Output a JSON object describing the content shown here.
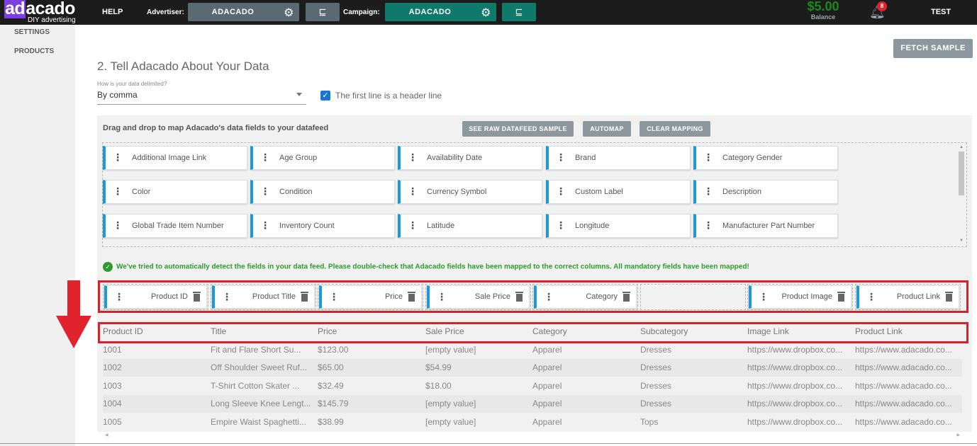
{
  "topbar": {
    "logo_ad": "ad",
    "logo_rest": "acado",
    "logo_sub": "DIY advertising",
    "help": "HELP",
    "advertiser_label": "Advertiser:",
    "advertiser_value": "ADACADO",
    "campaign_label": "Campaign:",
    "campaign_value": "ADACADO",
    "balance_amount": "$5.00",
    "balance_label": "Balance",
    "notification_count": "8",
    "user": "TEST"
  },
  "sidebar": {
    "items": [
      {
        "label": "SETTINGS"
      },
      {
        "label": "PRODUCTS"
      }
    ]
  },
  "main": {
    "fetch_sample": "FETCH SAMPLE",
    "title": "2. Tell Adacado About Your Data",
    "delimiter_label": "How is your data delimited?",
    "delimiter_value": "By comma",
    "header_line_label": "The first line is a header line",
    "drag_title": "Drag and drop to map Adacado's data fields to your datafeed",
    "buttons": {
      "raw_sample": "SEE RAW DATAFEED SAMPLE",
      "automap": "AUTOMAP",
      "clear_mapping": "CLEAR MAPPING"
    },
    "available_fields": [
      "Additional Image Link",
      "Age Group",
      "Availability Date",
      "Brand",
      "Category Gender",
      "Color",
      "Condition",
      "Currency Symbol",
      "Custom Label",
      "Description",
      "Global Trade Item Number",
      "Inventory Count",
      "Latitude",
      "Longitude",
      "Manufacturer Part Number"
    ],
    "notice": "We've tried to automatically detect the fields in your data feed. Please double-check that Adacado fields have been mapped to the correct columns. All mandatory fields have been mapped!",
    "mapped_fields": [
      "Product ID",
      "Product Title",
      "Price",
      "Sale Price",
      "Category",
      "",
      "Product Image",
      "Product Link"
    ],
    "table": {
      "headers": [
        "Product ID",
        "Title",
        "Price",
        "Sale Price",
        "Category",
        "Subcategory",
        "Image Link",
        "Product Link"
      ],
      "rows": [
        [
          "1001",
          "Fit and Flare Short Su...",
          "$123.00",
          "[empty value]",
          "Apparel",
          "Dresses",
          "https://www.dropbox.co...",
          "https://www.adacado.co..."
        ],
        [
          "1002",
          "Off Shoulder Sweet Ruf...",
          "$65.00",
          "$54.99",
          "Apparel",
          "Dresses",
          "https://www.dropbox.co...",
          "https://www.adacado.co..."
        ],
        [
          "1003",
          "T-Shirt Cotton Skater ...",
          "$32.49",
          "$18.00",
          "Apparel",
          "Dresses",
          "https://www.dropbox.co...",
          "https://www.adacado.co..."
        ],
        [
          "1004",
          "Long Sleeve Knee Lengt...",
          "$145.79",
          "[empty value]",
          "Apparel",
          "Dresses",
          "https://www.dropbox.co...",
          "https://www.adacado.co..."
        ],
        [
          "1005",
          "Empire Waist Spaghetti...",
          "$38.99",
          "[empty value]",
          "Apparel",
          "Tops",
          "https://www.dropbox.co...",
          "https://www.adacado.co..."
        ]
      ]
    }
  },
  "icons": {
    "gear": "gear-icon",
    "tree": "tree-icon",
    "bell": "bell-icon",
    "drag": "drag-handle-icon",
    "trash": "trash-icon",
    "check": "check-circle-icon",
    "arrow": "red-down-arrow"
  },
  "colors": {
    "topbar": "#1c1c1c",
    "logo_accent": "#7b3fe4",
    "advertiser": "#5a6a73",
    "campaign": "#107a6a",
    "balance": "#1a8a1a",
    "chip_accent": "#1b9ad6",
    "highlight": "#d3232e",
    "notice": "#2e9a2e"
  }
}
